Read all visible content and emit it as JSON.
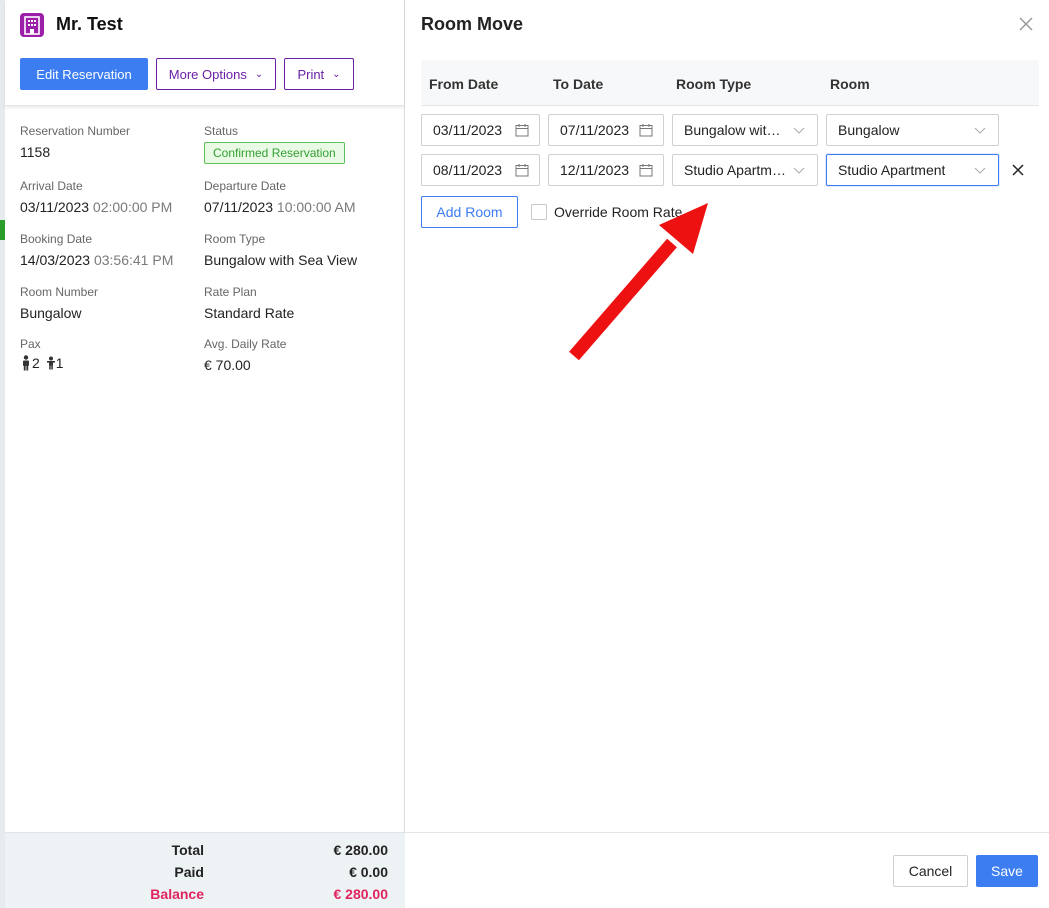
{
  "guest": {
    "name": "Mr. Test",
    "icon": "building-icon",
    "icon_color": "#9b1fa8"
  },
  "toolbar": {
    "edit_label": "Edit Reservation",
    "more_options_label": "More Options",
    "print_label": "Print"
  },
  "reservation": {
    "number_label": "Reservation Number",
    "number": "1158",
    "status_label": "Status",
    "status": "Confirmed Reservation",
    "arrival_label": "Arrival Date",
    "arrival_date": "03/11/2023",
    "arrival_time": "02:00:00 PM",
    "departure_label": "Departure Date",
    "departure_date": "07/11/2023",
    "departure_time": "10:00:00 AM",
    "booking_label": "Booking Date",
    "booking_date": "14/03/2023",
    "booking_time": "03:56:41 PM",
    "room_type_label": "Room Type",
    "room_type": "Bungalow with Sea View",
    "room_number_label": "Room Number",
    "room_number": "Bungalow",
    "rate_plan_label": "Rate Plan",
    "rate_plan": "Standard Rate",
    "pax_label": "Pax",
    "pax_adults": "2",
    "pax_children": "1",
    "adr_label": "Avg. Daily Rate",
    "adr": "€ 70.00"
  },
  "totals": {
    "total_label": "Total",
    "total": "€ 280.00",
    "paid_label": "Paid",
    "paid": "€ 0.00",
    "balance_label": "Balance",
    "balance": "€ 280.00",
    "balance_color": "#e0245e"
  },
  "modal": {
    "title": "Room Move",
    "columns": {
      "from": "From Date",
      "to": "To Date",
      "room_type": "Room Type",
      "room": "Room"
    },
    "rows": [
      {
        "from_date": "03/11/2023",
        "to_date": "07/11/2023",
        "room_type": "Bungalow with Sea View",
        "room": "Bungalow"
      },
      {
        "from_date": "08/11/2023",
        "to_date": "12/11/2023",
        "room_type": "Studio Apartment",
        "room": "Studio Apartment"
      }
    ],
    "add_room_label": "Add Room",
    "override_label": "Override Room Rate",
    "override_checked": false,
    "cancel_label": "Cancel",
    "save_label": "Save"
  },
  "colors": {
    "primary": "#3c7df2",
    "purple": "#6a1fa6",
    "status_green": "#33a033",
    "annotation_arrow": "#ee1111"
  }
}
